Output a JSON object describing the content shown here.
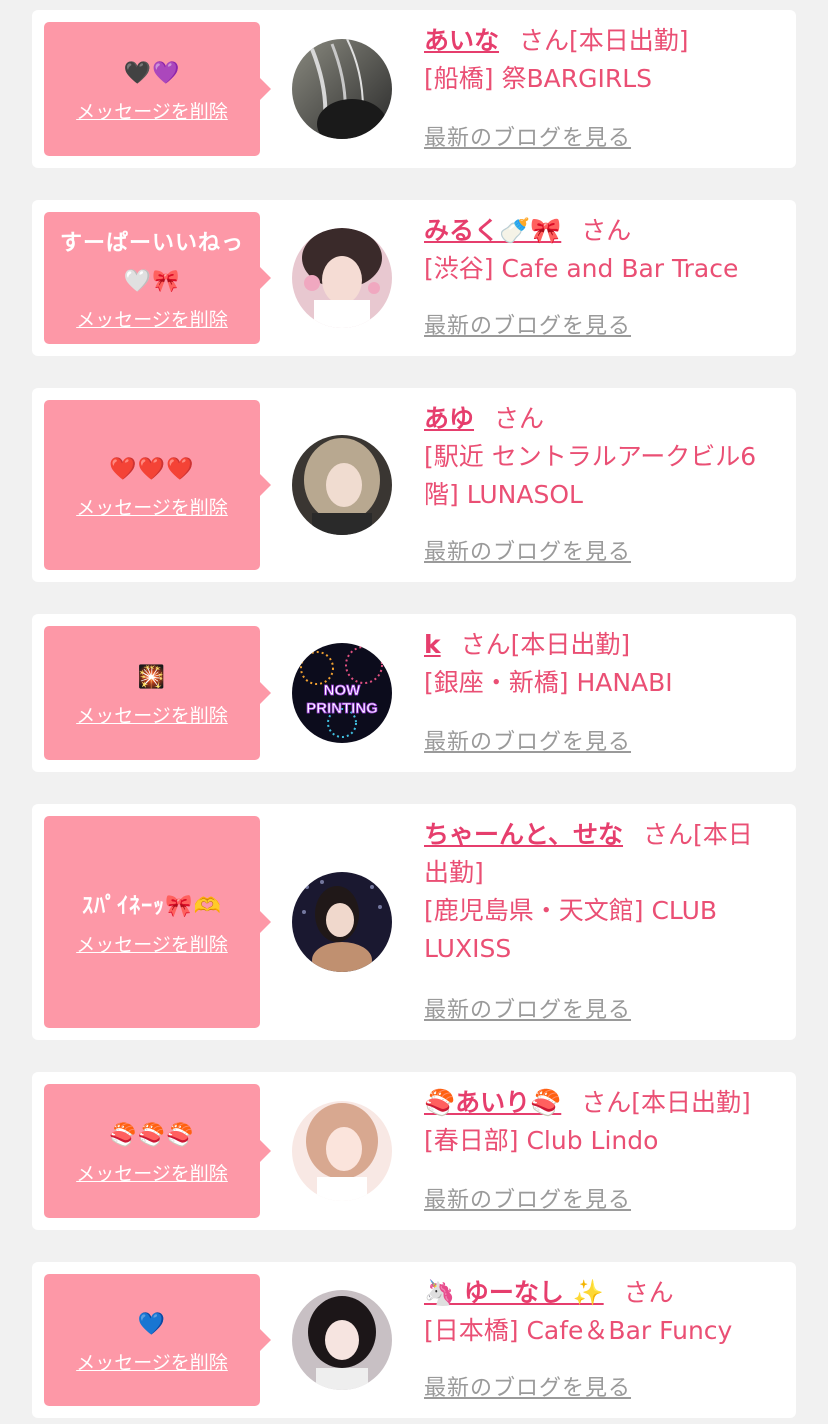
{
  "entries": [
    {
      "message": "🖤💜",
      "delete_label": "メッセージを削除",
      "name": "あいな",
      "suffix": "さん[本日出勤]",
      "shop": "[船橋] 祭BARGIRLS",
      "blog_label": "最新のブログを見る"
    },
    {
      "message": "すーぱーいいねっ🤍🎀",
      "delete_label": "メッセージを削除",
      "name": "みるく🍼🎀",
      "suffix": "さん",
      "shop": "[渋谷] Cafe and Bar Trace",
      "blog_label": "最新のブログを見る"
    },
    {
      "message": "❤️❤️❤️",
      "delete_label": "メッセージを削除",
      "name": "あゆ",
      "suffix": "さん",
      "shop": "[駅近 セントラルアークビル6階] LUNASOL",
      "blog_label": "最新のブログを見る"
    },
    {
      "message": "🎇",
      "delete_label": "メッセージを削除",
      "name": "k",
      "suffix": "さん[本日出勤]",
      "shop": "[銀座・新橋] HANABI",
      "blog_label": "最新のブログを見る"
    },
    {
      "message": "ｽﾊﾟｲﾈｰｯ🎀🫶",
      "delete_label": "メッセージを削除",
      "name": "ちゃーんと、せな",
      "suffix": "さん[本日出勤]",
      "shop": "[鹿児島県・天文館] CLUB LUXISS",
      "blog_label": "最新のブログを見る"
    },
    {
      "message": "🍣🍣🍣",
      "delete_label": "メッセージを削除",
      "name": "🍣あいり🍣",
      "suffix": "さん[本日出勤]",
      "shop": "[春日部] Club Lindo",
      "blog_label": "最新のブログを見る"
    },
    {
      "message": "💙",
      "delete_label": "メッセージを削除",
      "name": "🦄 ゆーなし ✨",
      "suffix": "さん",
      "shop": "[日本橋] Cafe＆Bar Funcy",
      "blog_label": "最新のブログを見る"
    }
  ],
  "avatars": [
    {
      "icon": "avatar-photo",
      "label": ""
    },
    {
      "icon": "avatar-photo",
      "label": ""
    },
    {
      "icon": "avatar-photo",
      "label": ""
    },
    {
      "icon": "avatar-fireworks",
      "label": "NOW PRINTING"
    },
    {
      "icon": "avatar-photo",
      "label": ""
    },
    {
      "icon": "avatar-photo",
      "label": ""
    },
    {
      "icon": "avatar-photo",
      "label": ""
    }
  ],
  "colors": {
    "bubble": "#fd98a7",
    "name": "#e63e6d",
    "shop": "#ea4f74",
    "link": "#9a9a9a",
    "background": "#f1f1f1"
  }
}
